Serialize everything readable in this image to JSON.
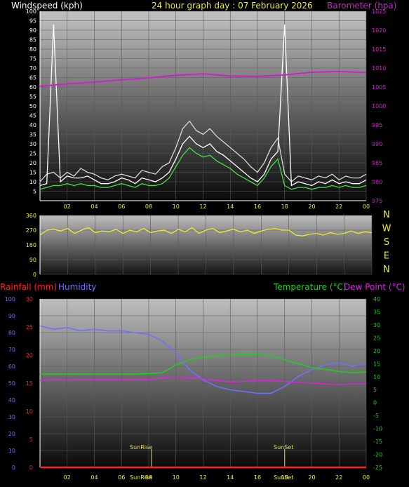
{
  "colors": {
    "windspeed": "#ffffff",
    "gust": "#d8d8d8",
    "avgwind": "#44e044",
    "barometer": "#cc22cc",
    "direction": "#eeee22",
    "rain": "#ff2020",
    "humidity": "#7070ff",
    "temperature": "#22cc22",
    "dewpoint": "#dd22dd",
    "sunmark": "#dddd55",
    "date": "#eeee33"
  },
  "header": {
    "windspeed_label": "Windspeed (kph)",
    "title": "24 hour graph day : 07 February 2026",
    "barometer_label": "Barometer (hpa)"
  },
  "x_ticks": [
    "02",
    "04",
    "06",
    "08",
    "10",
    "12",
    "14",
    "16",
    "18",
    "20",
    "22",
    "00"
  ],
  "chart_data": [
    {
      "type": "line",
      "name": "wind-barometer",
      "x_range": [
        0,
        24
      ],
      "left_axis": {
        "ticks": [
          5,
          10,
          15,
          20,
          25,
          30,
          35,
          40,
          45,
          50,
          55,
          60,
          65,
          70,
          75,
          80,
          85,
          90,
          95,
          100
        ],
        "range": [
          0,
          100
        ]
      },
      "right_axis": {
        "ticks": [
          975,
          980,
          985,
          990,
          995,
          1000,
          1005,
          1010,
          1015,
          1020,
          1025
        ],
        "range": [
          975,
          1025
        ]
      },
      "series": [
        {
          "key": "gust",
          "x": [
            0.0,
            0.5,
            1.0,
            1.5,
            2.0,
            2.5,
            3.0,
            3.5,
            4.0,
            4.5,
            5.0,
            5.5,
            6.0,
            6.5,
            7.0,
            7.5,
            8.0,
            8.5,
            9.0,
            9.5,
            10.0,
            10.5,
            11.0,
            11.5,
            12.0,
            12.5,
            13.0,
            13.5,
            14.0,
            14.5,
            15.0,
            15.5,
            16.0,
            16.5,
            17.0,
            17.5,
            18.0,
            18.5,
            19.0,
            19.5,
            20.0,
            20.5,
            21.0,
            21.5,
            22.0,
            22.5,
            23.0,
            23.5,
            24.0
          ],
          "y": [
            10,
            14,
            15,
            12,
            15,
            13,
            17,
            15,
            14,
            12,
            11,
            13,
            14,
            13,
            12,
            16,
            15,
            14,
            18,
            20,
            28,
            38,
            42,
            37,
            35,
            38,
            34,
            31,
            28,
            25,
            22,
            18,
            15,
            20,
            28,
            33,
            14,
            10,
            13,
            12,
            11,
            13,
            12,
            14,
            11,
            13,
            12,
            12,
            14
          ]
        },
        {
          "key": "windspeed",
          "x": [
            0.0,
            0.5,
            1.0,
            1.5,
            2.0,
            2.5,
            3.0,
            3.5,
            4.0,
            4.5,
            5.0,
            5.5,
            6.0,
            6.5,
            7.0,
            7.5,
            8.0,
            8.5,
            9.0,
            9.5,
            10.0,
            10.5,
            11.0,
            11.5,
            12.0,
            12.5,
            13.0,
            13.5,
            14.0,
            14.5,
            15.0,
            15.5,
            16.0,
            16.5,
            17.0,
            17.5,
            18.0,
            18.5,
            19.0,
            19.5,
            20.0,
            20.5,
            21.0,
            21.5,
            22.0,
            22.5,
            23.0,
            23.5,
            24.0
          ],
          "y": [
            8,
            9,
            93,
            10,
            13,
            12,
            12,
            13,
            11,
            9,
            9,
            10,
            12,
            11,
            9,
            12,
            11,
            10,
            12,
            15,
            22,
            30,
            34,
            30,
            28,
            30,
            26,
            24,
            21,
            18,
            15,
            12,
            10,
            14,
            22,
            26,
            93,
            8,
            10,
            9,
            8,
            10,
            9,
            11,
            9,
            10,
            9,
            9,
            11
          ]
        },
        {
          "key": "avgwind",
          "x": [
            0.0,
            0.5,
            1.0,
            1.5,
            2.0,
            2.5,
            3.0,
            3.5,
            4.0,
            4.5,
            5.0,
            5.5,
            6.0,
            6.5,
            7.0,
            7.5,
            8.0,
            8.5,
            9.0,
            9.5,
            10.0,
            10.5,
            11.0,
            11.5,
            12.0,
            12.5,
            13.0,
            13.5,
            14.0,
            14.5,
            15.0,
            15.5,
            16.0,
            16.5,
            17.0,
            17.5,
            18.0,
            18.5,
            19.0,
            19.5,
            20.0,
            20.5,
            21.0,
            21.5,
            22.0,
            22.5,
            23.0,
            23.5,
            24.0
          ],
          "y": [
            6,
            7,
            8,
            8,
            9,
            8,
            9,
            8,
            8,
            7,
            7,
            8,
            9,
            8,
            7,
            9,
            8,
            8,
            9,
            12,
            18,
            24,
            28,
            25,
            23,
            24,
            21,
            19,
            17,
            14,
            12,
            10,
            8,
            12,
            18,
            22,
            8,
            6,
            7,
            7,
            6,
            7,
            7,
            8,
            7,
            8,
            7,
            7,
            8
          ]
        },
        {
          "key": "barometer",
          "axis": "right",
          "x": [
            0,
            2,
            4,
            6,
            8,
            10,
            12,
            14,
            16,
            18,
            20,
            22,
            24
          ],
          "y": [
            1005.2,
            1005.8,
            1006.3,
            1006.9,
            1007.4,
            1008.1,
            1008.5,
            1007.9,
            1007.8,
            1008.2,
            1008.9,
            1009.1,
            1008.8
          ]
        }
      ]
    },
    {
      "type": "scatter",
      "name": "wind-direction",
      "x_range": [
        0,
        24
      ],
      "y_axis": {
        "ticks": [
          0,
          90,
          180,
          270,
          360
        ],
        "range": [
          0,
          360
        ]
      },
      "side_labels": [
        "N",
        "W",
        "S",
        "E",
        "N"
      ],
      "series": [
        {
          "key": "direction",
          "x": [
            0.0,
            0.5,
            1.0,
            1.5,
            2.0,
            2.5,
            3.0,
            3.5,
            4.0,
            4.5,
            5.0,
            5.5,
            6.0,
            6.5,
            7.0,
            7.5,
            8.0,
            8.5,
            9.0,
            9.5,
            10.0,
            10.5,
            11.0,
            11.5,
            12.0,
            12.5,
            13.0,
            13.5,
            14.0,
            14.5,
            15.0,
            15.5,
            16.0,
            16.5,
            17.0,
            17.5,
            18.0,
            18.5,
            19.0,
            19.5,
            20.0,
            20.5,
            21.0,
            21.5,
            22.0,
            22.5,
            23.0,
            23.5,
            24.0
          ],
          "y": [
            240,
            270,
            275,
            265,
            280,
            250,
            270,
            285,
            255,
            265,
            260,
            275,
            250,
            270,
            260,
            280,
            255,
            265,
            270,
            250,
            275,
            260,
            285,
            250,
            270,
            280,
            255,
            265,
            275,
            260,
            270,
            250,
            265,
            275,
            280,
            270,
            270,
            240,
            235,
            245,
            250,
            240,
            255,
            245,
            250,
            265,
            250,
            260,
            255
          ]
        }
      ]
    },
    {
      "type": "line",
      "name": "rain-humidity-temperature",
      "x_range": [
        0,
        24
      ],
      "rain_axis": {
        "ticks": [
          0,
          5,
          10,
          15,
          20,
          25,
          30
        ],
        "range": [
          0,
          30
        ]
      },
      "humidity_axis": {
        "ticks": [
          0,
          10,
          20,
          30,
          40,
          50,
          60,
          70,
          80,
          90,
          100
        ],
        "range": [
          0,
          100
        ]
      },
      "temp_axis": {
        "ticks": [
          -25,
          -20,
          -15,
          -10,
          -5,
          0,
          5,
          10,
          15,
          20,
          25,
          30,
          35,
          40
        ],
        "range": [
          -25,
          40
        ]
      },
      "labels": {
        "rain": "Rainfall (mm)",
        "humidity": "Humidity",
        "temperature": "Temperature (°C)",
        "dewpoint": "Dew Point (°C)",
        "sunrise": "SunRise",
        "sunset": "SunSet",
        "sunrise_x": "SunRise",
        "sunset_x": "SunSet"
      },
      "sunrise_hour": 8.2,
      "sunset_hour": 18.0,
      "series": [
        {
          "key": "humidity",
          "x": [
            0,
            1,
            2,
            3,
            4,
            5,
            6,
            7,
            8,
            9,
            10,
            11,
            12,
            13,
            14,
            15,
            16,
            17,
            18,
            19,
            20,
            21,
            22,
            23,
            24
          ],
          "y": [
            84,
            82,
            83,
            81,
            82,
            81,
            81,
            80,
            79,
            75,
            68,
            58,
            52,
            48,
            46,
            45,
            44,
            44,
            48,
            54,
            58,
            61,
            62,
            60,
            62
          ]
        },
        {
          "key": "temperature",
          "x": [
            0,
            1,
            2,
            3,
            4,
            5,
            6,
            7,
            8,
            9,
            10,
            11,
            12,
            13,
            14,
            15,
            16,
            17,
            18,
            19,
            20,
            21,
            22,
            23,
            24
          ],
          "y": [
            11,
            11,
            11,
            11,
            11,
            11,
            11,
            11,
            11.2,
            11.5,
            14.5,
            16.5,
            17.5,
            18,
            18.5,
            18.8,
            18.8,
            18.2,
            16.5,
            15,
            13.5,
            12.8,
            12,
            11.5,
            11.8
          ]
        },
        {
          "key": "dewpoint",
          "x": [
            0,
            1,
            2,
            3,
            4,
            5,
            6,
            7,
            8,
            9,
            10,
            11,
            12,
            13,
            14,
            15,
            16,
            17,
            18,
            19,
            20,
            21,
            22,
            23,
            24
          ],
          "y": [
            8.5,
            8.8,
            8.7,
            8.8,
            8.9,
            8.9,
            8.9,
            8.8,
            8.9,
            9.5,
            9.8,
            9.5,
            9.2,
            8.5,
            8.0,
            8.2,
            8.5,
            8.5,
            8.2,
            7.8,
            7.5,
            7.2,
            7.0,
            7.2,
            7.3
          ]
        },
        {
          "key": "rain",
          "x": [
            0,
            24
          ],
          "y": [
            0,
            0
          ]
        }
      ]
    }
  ]
}
